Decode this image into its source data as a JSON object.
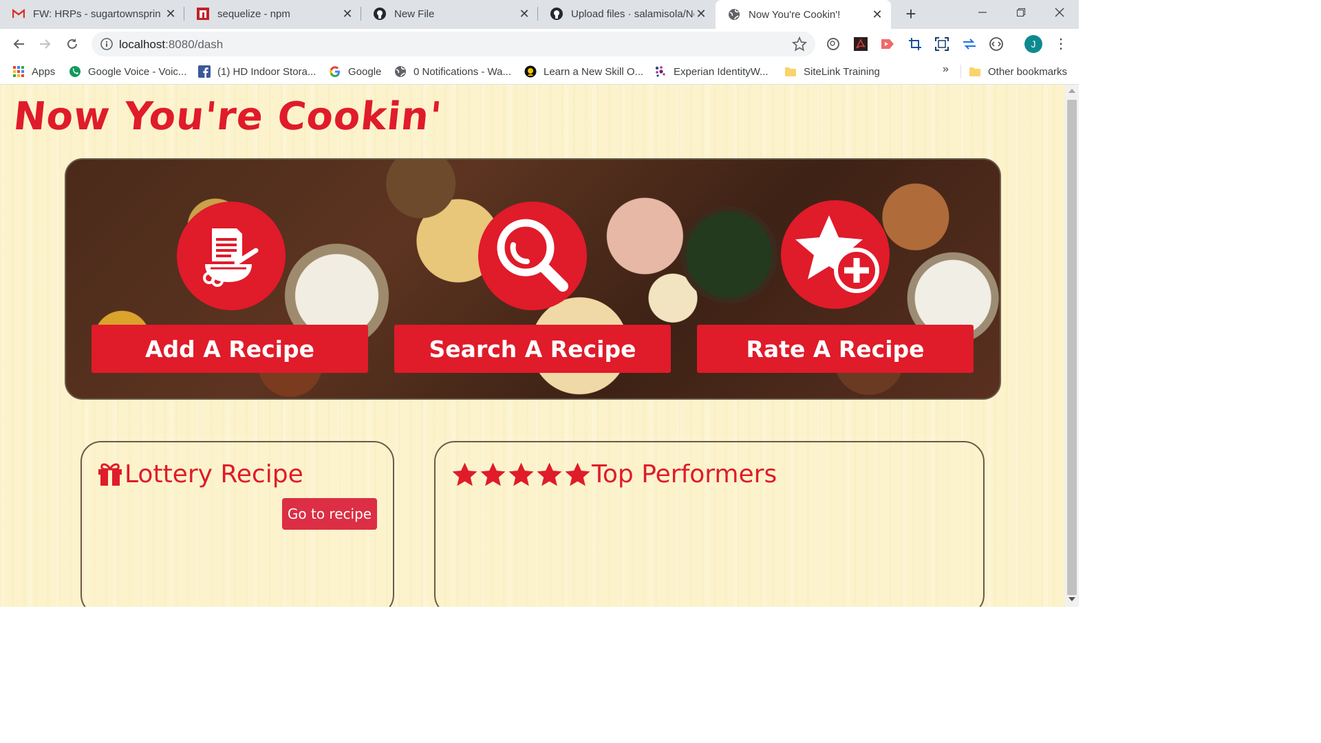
{
  "browser": {
    "tabs": [
      {
        "title": "FW: HRPs - sugartownsprin",
        "icon": "gmail-icon"
      },
      {
        "title": "sequelize - npm",
        "icon": "npm-icon"
      },
      {
        "title": "New File",
        "icon": "github-icon"
      },
      {
        "title": "Upload files · salamisola/No",
        "icon": "github-icon"
      },
      {
        "title": "Now You're Cookin'!",
        "icon": "globe-icon",
        "active": true
      }
    ],
    "new_tab_label": "+",
    "url_host": "localhost",
    "url_path": ":8080/dash",
    "avatar_initial": "J",
    "bookmarks": [
      {
        "label": "Apps",
        "icon": "apps-grid-icon"
      },
      {
        "label": "Google Voice - Voic...",
        "icon": "google-voice-icon"
      },
      {
        "label": "(1) HD Indoor Stora...",
        "icon": "facebook-icon"
      },
      {
        "label": "Google",
        "icon": "google-icon"
      },
      {
        "label": "0 Notifications - Wa...",
        "icon": "globe-icon"
      },
      {
        "label": "Learn a New Skill O...",
        "icon": "skill-icon"
      },
      {
        "label": "Experian IdentityW...",
        "icon": "experian-icon"
      },
      {
        "label": "SiteLink Training",
        "icon": "folder-icon"
      }
    ],
    "bookmarks_overflow": "»",
    "other_bookmarks": "Other bookmarks"
  },
  "page": {
    "site_title": "Now You're Cookin'",
    "hero_actions": [
      {
        "label": "Add A Recipe",
        "icon": "recipe-bowl-icon"
      },
      {
        "label": "Search A Recipe",
        "icon": "search-magnifier-icon"
      },
      {
        "label": "Rate A Recipe",
        "icon": "star-plus-icon"
      }
    ],
    "lottery": {
      "title": "Lottery Recipe",
      "icon": "gift-icon",
      "button": "Go to recipe"
    },
    "top": {
      "title": "Top Performers",
      "stars": 5
    }
  },
  "colors": {
    "accent": "#e01b2a",
    "button": "#dc2e45",
    "page_background": "#fcf3cc"
  }
}
